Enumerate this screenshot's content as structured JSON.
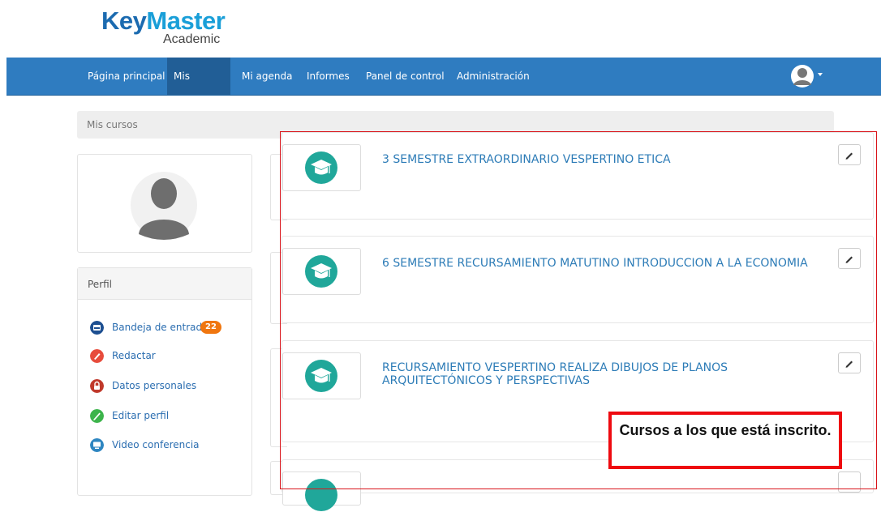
{
  "brand": {
    "name_part1": "Key",
    "name_part2": "Master",
    "sub": "Academic"
  },
  "nav": {
    "items": [
      {
        "label": "Página principal"
      },
      {
        "label": "Mis cursos"
      },
      {
        "label": "Mi agenda"
      },
      {
        "label": "Informes"
      },
      {
        "label": "Panel de control"
      },
      {
        "label": "Administración"
      }
    ],
    "active": "Mis cursos"
  },
  "breadcrumb": "Mis cursos",
  "profile": {
    "panel_title": "Perfil",
    "menu": [
      {
        "label": "Bandeja de entrada",
        "icon": "inbox-icon",
        "color": "#1d4f91",
        "badge": "22"
      },
      {
        "label": "Redactar",
        "icon": "compose-icon",
        "color": "#e74c3c"
      },
      {
        "label": "Datos personales",
        "icon": "lock-icon",
        "color": "#c0392b"
      },
      {
        "label": "Editar perfil",
        "icon": "pencil-icon",
        "color": "#3cb44b"
      },
      {
        "label": "Video conferencia",
        "icon": "video-conference-icon",
        "color": "#2e86c1"
      }
    ]
  },
  "courses": [
    {
      "title": "3 SEMESTRE EXTRAORDINARIO VESPERTINO ETICA",
      "icon": "graduation-cap-icon"
    },
    {
      "title": "6 SEMESTRE RECURSAMIENTO MATUTINO INTRODUCCION A LA ECONOMIA",
      "icon": "graduation-cap-icon"
    },
    {
      "title": "RECURSAMIENTO VESPERTINO REALIZA DIBUJOS DE PLANOS ARQUITECTÓNICOS Y PERSPECTIVAS",
      "icon": "graduation-cap-icon"
    }
  ],
  "callout": "Cursos a los que está inscrito.",
  "colors": {
    "navbar": "#2f7cc0",
    "accent": "#20a79a",
    "link": "#2d7cb7",
    "highlight": "#ee0a10"
  }
}
